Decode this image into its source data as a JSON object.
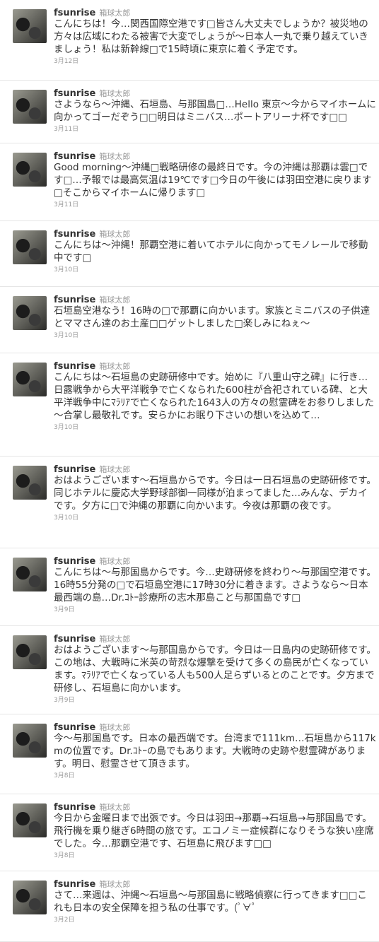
{
  "tweets": [
    {
      "user": "fsunrise",
      "name": "箱球太郎",
      "text": "こんにちは！今…関西国際空港です□皆さん大丈夫でしょうか？被災地の方々は広域にわたる被害で大変でしょうが～日本人一丸で乗り越えていきましょう！私は新幹線□で15時頃に東京に着く予定です。",
      "date": "3月12日"
    },
    {
      "user": "fsunrise",
      "name": "箱球太郎",
      "text": "さようなら～沖縄、石垣島、与那国島□…Hello 東京～今からマイホームに向かってゴーだぞう□□明日はミニバス…ポートアリーナ杯です□□",
      "date": "3月11日"
    },
    {
      "user": "fsunrise",
      "name": "箱球太郎",
      "text": "Good morning～沖縄□戦略研修の最終日です。今の沖縄は那覇は雲□です□…予報では最高気温は19℃です□今日の午後には羽田空港に戻ります□そこからマイホームに帰ります□",
      "date": "3月11日"
    },
    {
      "user": "fsunrise",
      "name": "箱球太郎",
      "text": "こんにちは～沖縄！那覇空港に着いてホテルに向かってモノレールで移動中です□",
      "date": "3月10日"
    },
    {
      "user": "fsunrise",
      "name": "箱球太郎",
      "text": "石垣島空港なう！16時の□で那覇に向かいます。家族とミニバスの子供達とママさん達のお土産□□ゲットしました□楽しみにねぇ～",
      "date": "3月10日"
    },
    {
      "user": "fsunrise",
      "name": "箱球太郎",
      "text": "こんにちは～石垣島の史跡研修中です。始めに『八重山守之碑』に行き…日露戦争から大平洋戦争で亡くなられた600柱が合祀されている碑、と大平洋戦争中にﾏﾗﾘｱで亡くなられた1643人の方々の慰霊碑をお参りしました～合掌し最敬礼です。安らかにお眠り下さいの想いを込めて…",
      "date": "3月10日"
    },
    {
      "user": "fsunrise",
      "name": "箱球太郎",
      "text": "おはようございます～石垣島からです。今日は一日石垣島の史跡研修です。同じホテルに慶応大学野球部御一同様が泊まってました…みんな、デカイです。夕方に□で沖縄の那覇に向かいます。今夜は那覇の夜です。",
      "date": "3月10日"
    },
    {
      "user": "fsunrise",
      "name": "箱球太郎",
      "text": "こんにちは～与那国島からです。今…史跡研修を終わり～与那国空港です。16時55分発の□で石垣島空港に17時30分に着きます。さようなら～日本最西端の島…Dr.ｺﾄｰ診療所の志木那島こと与那国島です□",
      "date": "3月9日"
    },
    {
      "user": "fsunrise",
      "name": "箱球太郎",
      "text": "おはようございます～与那国島からです。今日は一日島内の史跡研修です。この地は、大戦時に米英の苛烈な爆撃を受けて多くの島民が亡くなっています。ﾏﾗﾘｱで亡くなっている人も500人足らずいるとのことです。夕方まで研修し、石垣島に向かいます。",
      "date": "3月9日"
    },
    {
      "user": "fsunrise",
      "name": "箱球太郎",
      "text": "今～与那国島です。日本の最西端です。台湾まで111km…石垣島から117kmの位置です。Dr.ｺﾄｰの島でもあります。大戦時の史跡や慰霊碑があります。明日、慰霊させて頂きます。",
      "date": "3月8日"
    },
    {
      "user": "fsunrise",
      "name": "箱球太郎",
      "text": "今日から金曜日まで出張です。今日は羽田→那覇→石垣島→与那国島です。飛行機を乗り継ぎ6時間の旅です。エコノミー症候群になりそうな狭い座席でした。今…那覇空港です、石垣島に飛びます□□",
      "date": "3月8日"
    },
    {
      "user": "fsunrise",
      "name": "箱球太郎",
      "text": "さて…来週は、沖縄～石垣島～与那国島に戦略偵察に行ってきます□□これも日本の安全保障を担う私の仕事です。(ﾟ∀ﾟ",
      "date": "3月2日"
    }
  ]
}
